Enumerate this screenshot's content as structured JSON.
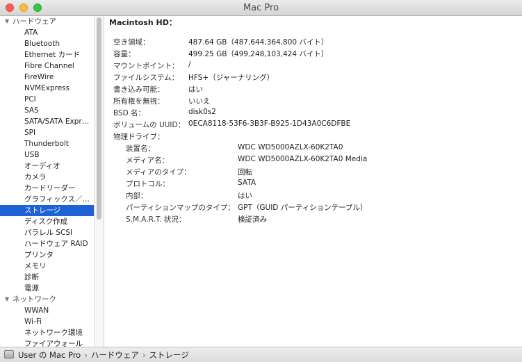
{
  "window": {
    "title": "Mac Pro"
  },
  "sidebar": {
    "groups": [
      {
        "label": "ハードウェア",
        "items": [
          "ATA",
          "Bluetooth",
          "Ethernet カード",
          "Fibre Channel",
          "FireWire",
          "NVMExpress",
          "PCI",
          "SAS",
          "SATA/SATA Expr…",
          "SPI",
          "Thunderbolt",
          "USB",
          "オーディオ",
          "カメラ",
          "カードリーダー",
          "グラフィックス／…",
          "ストレージ",
          "ディスク作成",
          "パラレル SCSI",
          "ハードウェア RAID",
          "プリンタ",
          "メモリ",
          "診断",
          "電源"
        ]
      },
      {
        "label": "ネットワーク",
        "items": [
          "WWAN",
          "Wi-Fi",
          "ネットワーク環境",
          "ファイアウォール"
        ]
      }
    ],
    "selected": "ストレージ"
  },
  "detail": {
    "section_title": "Macintosh HD：",
    "fields": [
      {
        "label": "空き領域：",
        "value": "487.64 GB（487,644,364,800 バイト）"
      },
      {
        "label": "容量：",
        "value": "499.25 GB（499,248,103,424 バイト）"
      },
      {
        "label": "マウントポイント：",
        "value": "/"
      },
      {
        "label": "ファイルシステム：",
        "value": "HFS+（ジャーナリング）"
      },
      {
        "label": "書き込み可能：",
        "value": "はい"
      },
      {
        "label": "所有権を無視：",
        "value": "いいえ"
      },
      {
        "label": "BSD 名：",
        "value": "disk0s2"
      },
      {
        "label": "ボリュームの UUID：",
        "value": "0ECA8118-53F6-3B3F-B925-1D43A0C6DFBE"
      }
    ],
    "physical_drive": {
      "label": "物理ドライブ：",
      "fields": [
        {
          "label": "装置名：",
          "value": "WDC WD5000AZLX-60K2TA0"
        },
        {
          "label": "メディア名：",
          "value": "WDC WD5000AZLX-60K2TA0 Media"
        },
        {
          "label": "メディアのタイプ：",
          "value": "回転"
        },
        {
          "label": "プロトコル：",
          "value": "SATA"
        },
        {
          "label": "内部：",
          "value": "はい"
        },
        {
          "label": "パーティションマップのタイプ：",
          "value": "GPT（GUID パーティションテーブル）"
        },
        {
          "label": "S.M.A.R.T. 状況：",
          "value": "検証済み"
        }
      ]
    }
  },
  "statusbar": {
    "breadcrumb": [
      "User の Mac Pro",
      "ハードウェア",
      "ストレージ"
    ],
    "separator": "›",
    "icon": "hard-drive-icon"
  },
  "colors": {
    "selection": "#1d63d6",
    "close": "#fc605c",
    "minimize": "#fdbc40",
    "maximize": "#34c749"
  }
}
